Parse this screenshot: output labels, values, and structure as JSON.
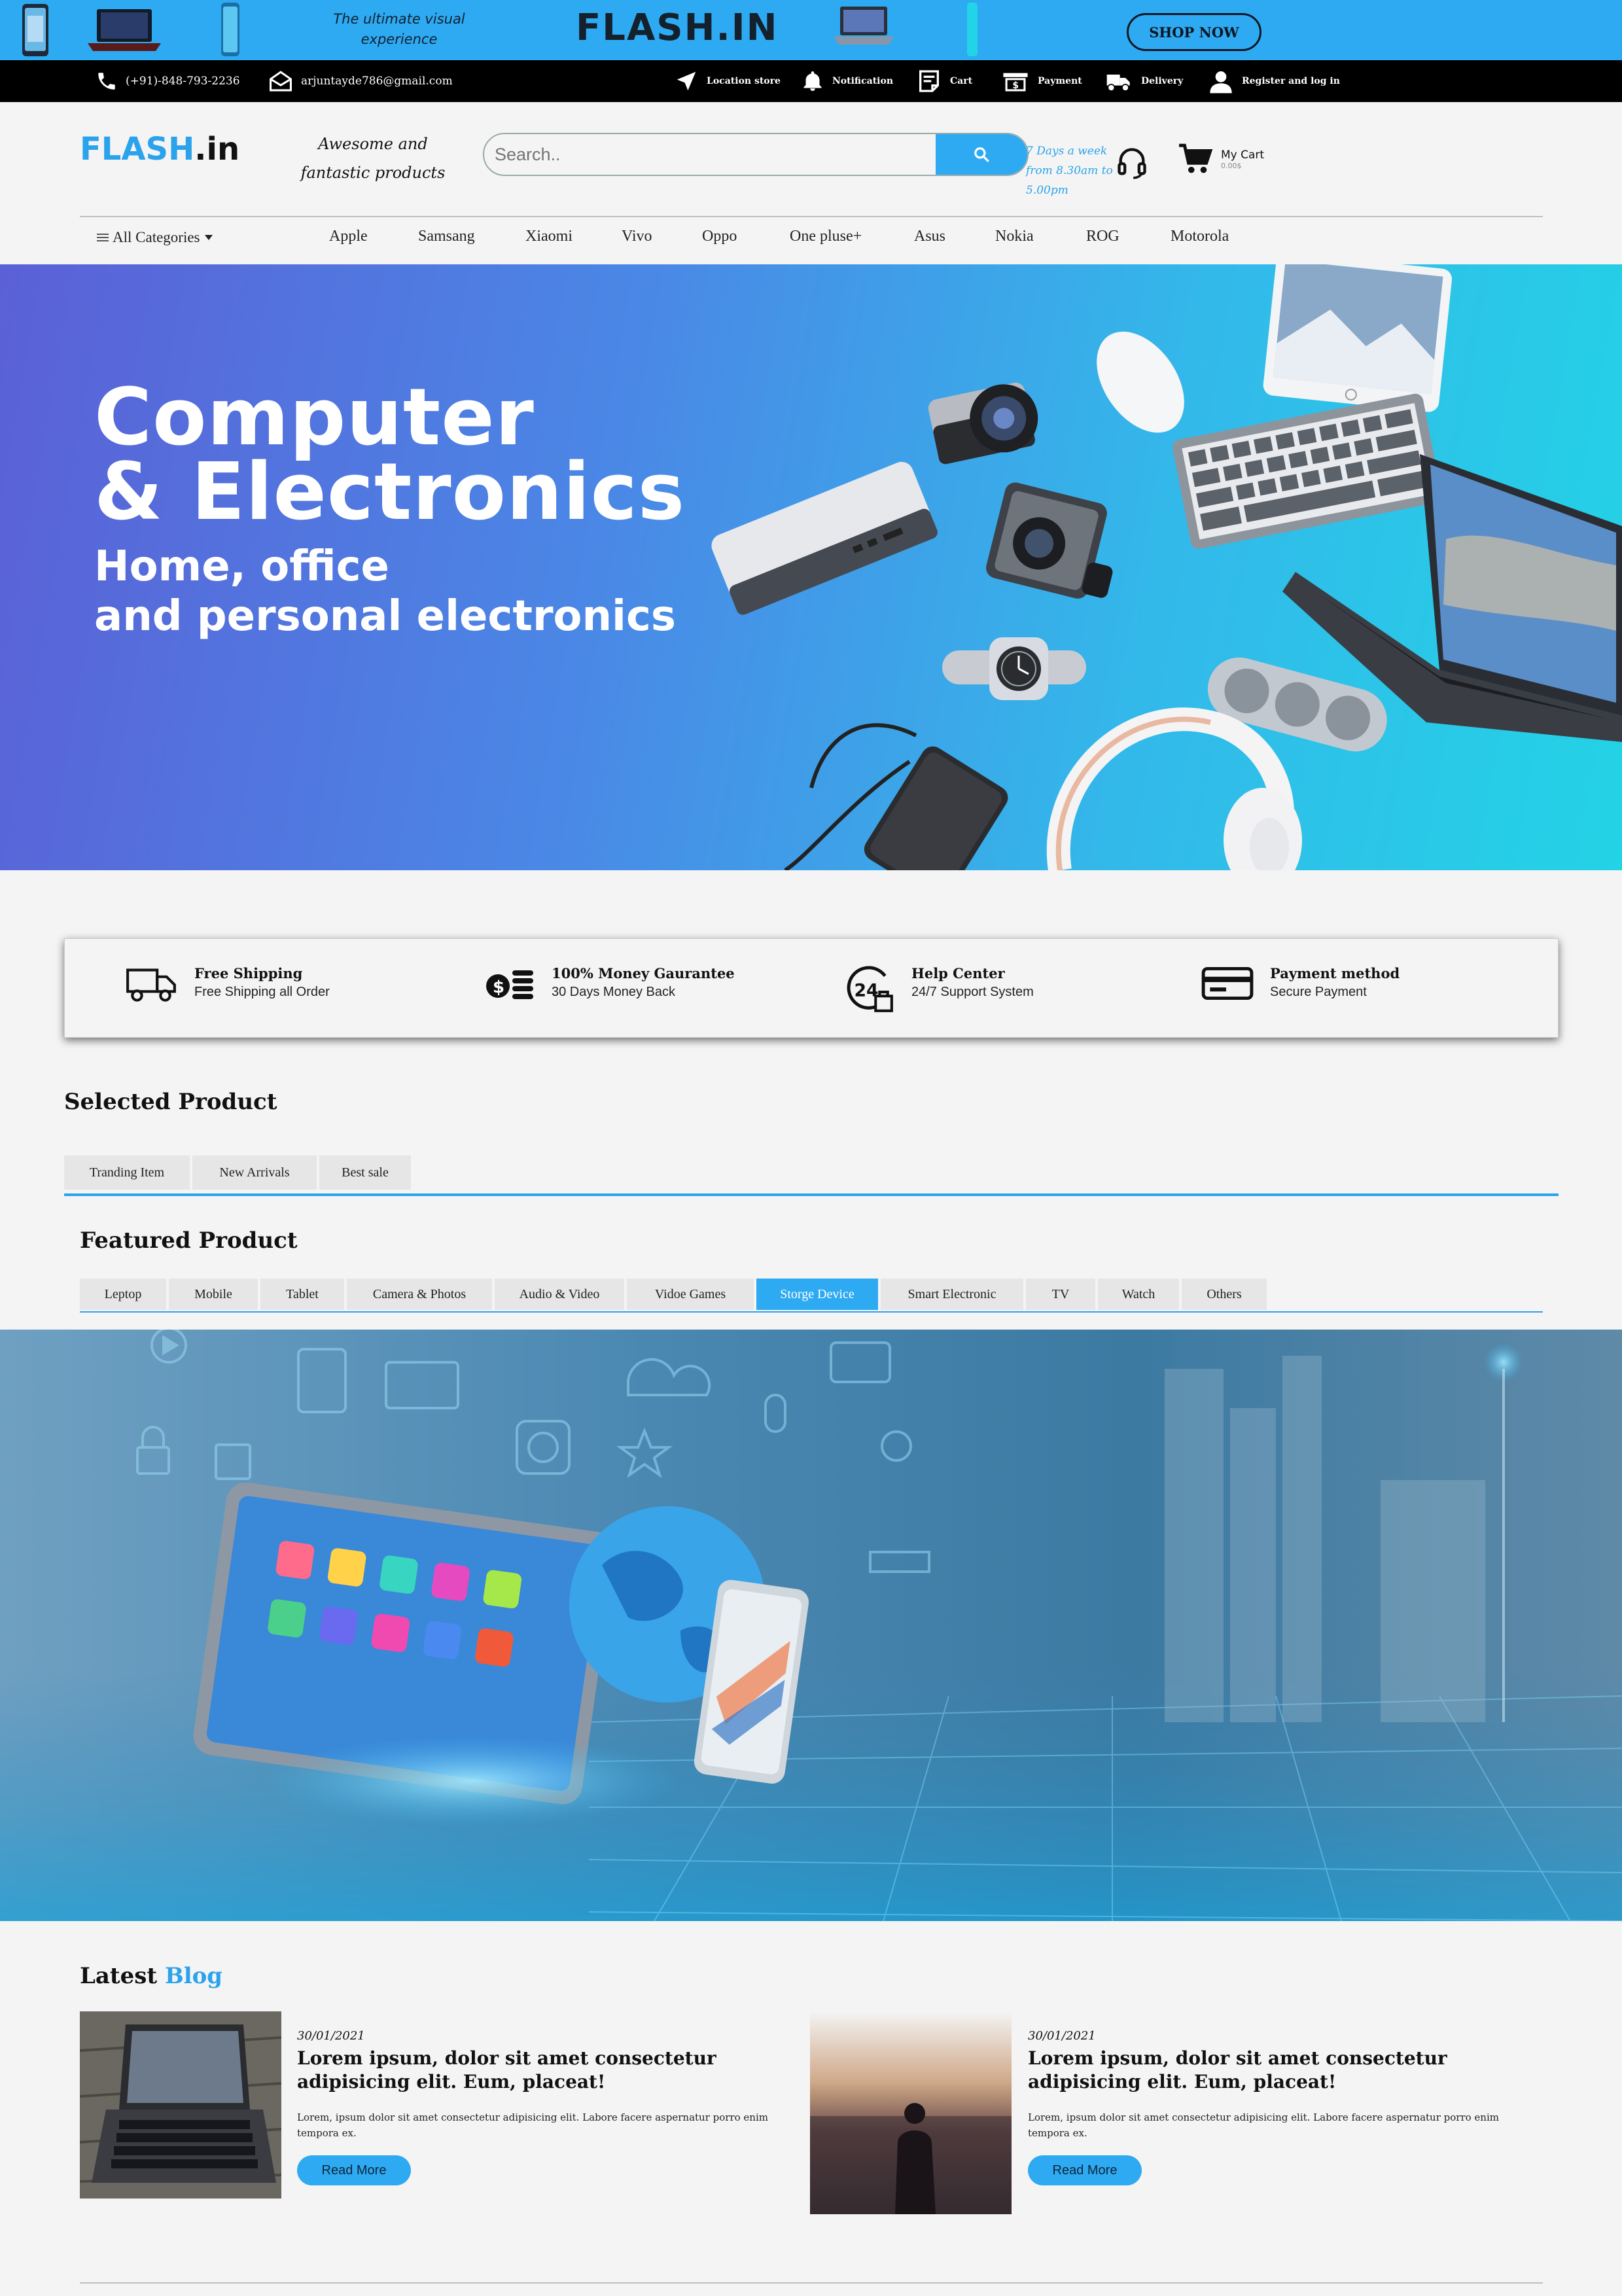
{
  "promo": {
    "tagline": "The ultimate visual experience",
    "logo": "FLASH.IN",
    "cta": "SHOP NOW"
  },
  "contact_bar": {
    "phone": "(+91)-848-793-2236",
    "email": "arjuntayde786@gmail.com",
    "links": [
      "Location store",
      "Notification",
      "Cart",
      "Payment",
      "Delivery",
      "Register and log in"
    ]
  },
  "header": {
    "logo_main": "FLASH",
    "logo_tld": ".in",
    "tagline": "Awesome and fantastic products",
    "search_placeholder": "Search..",
    "hours": "7 Days a week from 8.30am to 5.00pm",
    "cart_label": "My Cart",
    "cart_amount": "0.00$"
  },
  "nav": {
    "all_categories": "All Categories",
    "brands": [
      "Apple",
      "Samsang",
      "Xiaomi",
      "Vivo",
      "Oppo",
      "One pluse+",
      "Asus",
      "Nokia",
      "ROG",
      "Motorola"
    ]
  },
  "hero": {
    "title_line1": "Computer",
    "title_line2": "& Electronics",
    "sub_line1": "Home, office",
    "sub_line2": "and personal electronics"
  },
  "features": [
    {
      "title": "Free Shipping",
      "subtitle": "Free Shipping all Order",
      "icon": "truck-icon"
    },
    {
      "title": "100% Money Gaurantee",
      "subtitle": "30 Days Money Back",
      "icon": "coins-icon"
    },
    {
      "title": "Help Center",
      "subtitle": "24/7 Support System",
      "icon": "support-24-icon"
    },
    {
      "title": "Payment method",
      "subtitle": "Secure Payment",
      "icon": "card-icon"
    }
  ],
  "selected_product": {
    "title": "Selected Product",
    "tabs": [
      "Tranding Item",
      "New Arrivals",
      "Best sale"
    ]
  },
  "featured_product": {
    "title": "Featured Product",
    "tabs": [
      "Leptop",
      "Mobile",
      "Tablet",
      "Camera & Photos",
      "Audio & Video",
      "Vidoe Games",
      "Storge Device",
      "Smart Electronic",
      "TV",
      "Watch",
      "Others"
    ],
    "active_tab": "Storge Device"
  },
  "blog": {
    "title_main": "Latest",
    "title_accent": "Blog",
    "posts": [
      {
        "date": "30/01/2021",
        "heading": "Lorem ipsum, dolor sit amet consectetur adipisicing elit. Eum, placeat!",
        "text": "Lorem, ipsum dolor sit amet consectetur adipisicing elit. Labore facere aspernatur porro enim tempora ex.",
        "button": "Read More"
      },
      {
        "date": "30/01/2021",
        "heading": "Lorem ipsum, dolor sit amet consectetur adipisicing elit. Eum, placeat!",
        "text": "Lorem, ipsum dolor sit amet consectetur adipisicing elit. Labore facere aspernatur porro enim tempora ex.",
        "button": "Read More"
      }
    ]
  },
  "colors": {
    "accent": "#2eaaf2",
    "contact_bar": "#000000",
    "page_background": "#f4f4f4"
  }
}
